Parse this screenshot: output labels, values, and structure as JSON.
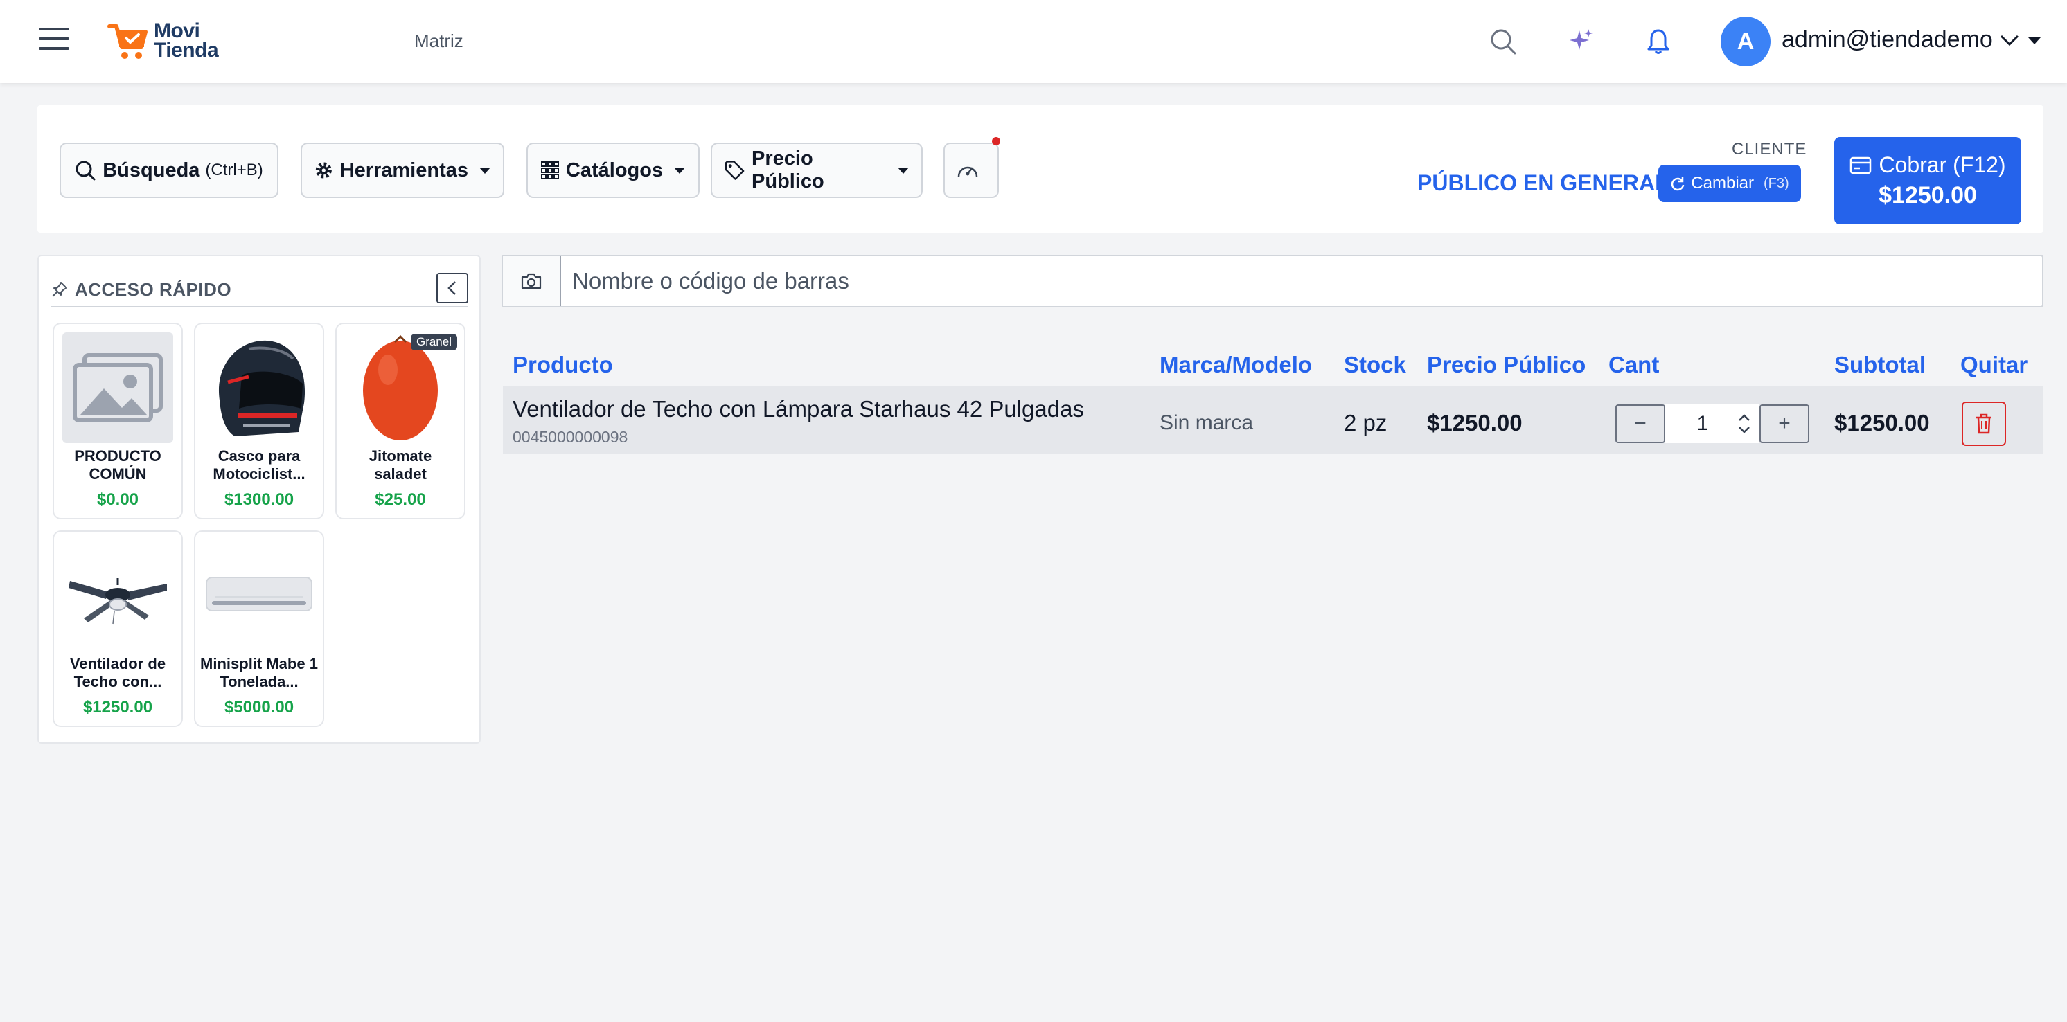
{
  "navbar": {
    "logo_line1": "Movi",
    "logo_line2": "Tienda",
    "branch": "Matriz",
    "user_initial": "A",
    "user_email": "admin@tiendademo"
  },
  "toolbar": {
    "search_label": "Búsqueda",
    "search_hint": "(Ctrl+B)",
    "tools_label": "Herramientas",
    "catalogs_label": "Catálogos",
    "price_label": "Precio Público",
    "cliente_caption": "CLIENTE",
    "cliente_name": "PÚBLICO EN GENERAL",
    "cambiar_label": "Cambiar",
    "cambiar_hint": "(F3)",
    "cobrar_label": "Cobrar (F12)",
    "cobrar_amount": "$1250.00"
  },
  "quick_access": {
    "title": "ACCESO RÁPIDO",
    "items": [
      {
        "name": "PRODUCTO COMÚN",
        "price": "$0.00"
      },
      {
        "name": "Casco para Motociclist...",
        "price": "$1300.00"
      },
      {
        "name": "Jitomate saladet",
        "price": "$25.00",
        "badge": "Granel"
      },
      {
        "name": "Ventilador de Techo con...",
        "price": "$1250.00"
      },
      {
        "name": "Minisplit Mabe 1 Tonelada...",
        "price": "$5000.00"
      }
    ]
  },
  "search": {
    "placeholder": "Nombre o código de barras"
  },
  "table": {
    "headers": {
      "product": "Producto",
      "brand": "Marca/Modelo",
      "stock": "Stock",
      "price": "Precio Público",
      "qty": "Cant",
      "subtotal": "Subtotal",
      "remove": "Quitar"
    },
    "rows": [
      {
        "name": "Ventilador de Techo con Lámpara Starhaus 42 Pulgadas",
        "code": "0045000000098",
        "brand": "Sin marca",
        "stock": "2 pz",
        "price": "$1250.00",
        "qty": "1",
        "subtotal": "$1250.00"
      }
    ]
  },
  "colors": {
    "accent": "#2563eb",
    "price_green": "#16a34a",
    "danger": "#dc2626",
    "logo_orange": "#f97316"
  },
  "icons": [
    "menu-icon",
    "cart-logo-icon",
    "search-icon",
    "sparkle-icon",
    "bell-icon",
    "chevron-down-icon",
    "gear-icon",
    "grid-icon",
    "tag-icon",
    "speedometer-icon",
    "refresh-icon",
    "card-icon",
    "pin-icon",
    "chevron-left-icon",
    "camera-icon",
    "trash-icon"
  ]
}
